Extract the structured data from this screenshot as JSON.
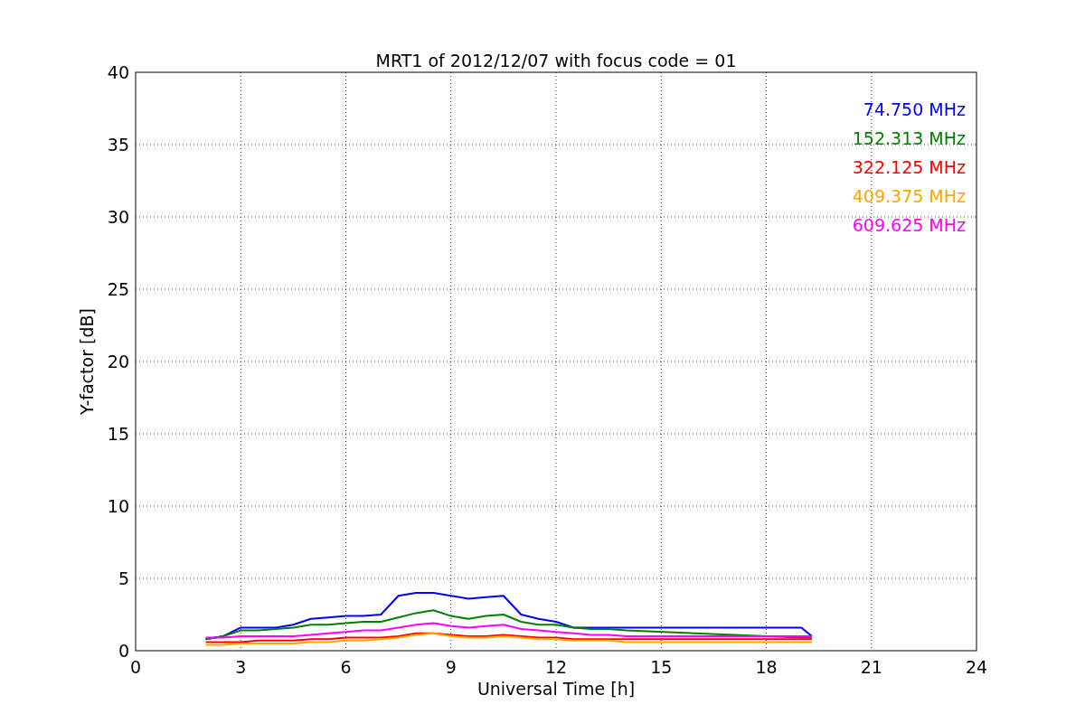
{
  "chart_data": {
    "type": "line",
    "title": "MRT1 of 2012/12/07 with focus code = 01",
    "xlabel": "Universal Time [h]",
    "ylabel": "Y-factor [dB]",
    "x": [
      2,
      2.5,
      3,
      3.5,
      4,
      4.5,
      5,
      5.5,
      6,
      6.5,
      7,
      7.5,
      8,
      8.5,
      9,
      9.5,
      10,
      10.5,
      11,
      11.5,
      12,
      12.5,
      13,
      13.5,
      14,
      19,
      19.3
    ],
    "series": [
      {
        "name": "74.750 MHz",
        "color": "#0000ff",
        "values": [
          0.8,
          1.0,
          1.6,
          1.6,
          1.6,
          1.8,
          2.2,
          2.3,
          2.4,
          2.4,
          2.5,
          3.8,
          4.0,
          4.0,
          3.8,
          3.6,
          3.7,
          3.8,
          2.5,
          2.2,
          2.0,
          1.6,
          1.6,
          1.6,
          1.6,
          1.6,
          1.0
        ]
      },
      {
        "name": "152.313 MHz",
        "color": "#008000",
        "values": [
          0.8,
          1.0,
          1.4,
          1.4,
          1.5,
          1.6,
          1.8,
          1.8,
          1.9,
          2.0,
          2.0,
          2.3,
          2.6,
          2.8,
          2.4,
          2.2,
          2.4,
          2.5,
          2.0,
          1.8,
          1.8,
          1.6,
          1.5,
          1.5,
          1.4,
          0.9,
          0.9
        ]
      },
      {
        "name": "322.125 MHz",
        "color": "#ff0000",
        "values": [
          0.6,
          0.6,
          0.6,
          0.7,
          0.7,
          0.7,
          0.8,
          0.8,
          0.9,
          0.9,
          0.9,
          1.0,
          1.2,
          1.2,
          1.1,
          1.0,
          1.0,
          1.1,
          1.0,
          0.9,
          0.9,
          0.8,
          0.8,
          0.8,
          0.8,
          0.8,
          0.8
        ]
      },
      {
        "name": "409.375 MHz",
        "color": "#ffa500",
        "values": [
          0.4,
          0.4,
          0.5,
          0.5,
          0.5,
          0.5,
          0.6,
          0.6,
          0.7,
          0.7,
          0.8,
          0.9,
          1.1,
          1.2,
          1.0,
          0.9,
          0.9,
          1.0,
          0.9,
          0.8,
          0.8,
          0.7,
          0.7,
          0.7,
          0.6,
          0.6,
          0.6
        ]
      },
      {
        "name": "609.625 MHz",
        "color": "#ff00ff",
        "values": [
          0.9,
          0.9,
          1.0,
          1.0,
          1.0,
          1.0,
          1.1,
          1.2,
          1.3,
          1.4,
          1.4,
          1.6,
          1.8,
          1.9,
          1.7,
          1.6,
          1.7,
          1.8,
          1.5,
          1.4,
          1.3,
          1.2,
          1.1,
          1.1,
          1.0,
          1.0,
          1.0
        ]
      }
    ],
    "grid": true,
    "xlim": [
      0,
      24
    ],
    "ylim": [
      0,
      40
    ],
    "xticks": [
      0,
      3,
      6,
      9,
      12,
      15,
      18,
      21,
      24
    ],
    "yticks": [
      0,
      5,
      10,
      15,
      20,
      25,
      30,
      35,
      40
    ]
  }
}
